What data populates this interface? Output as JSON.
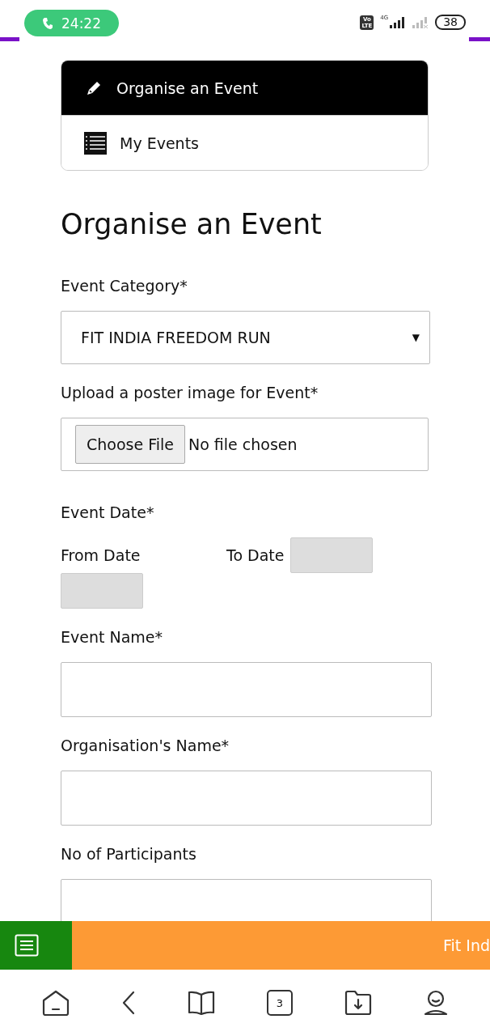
{
  "status_bar": {
    "call_time": "24:22",
    "volte_top": "Vo",
    "volte_bottom": "LTE",
    "network": "4G",
    "battery": "38"
  },
  "menu": [
    {
      "label": "Organise an Event",
      "kind": "pencil",
      "selected": true
    },
    {
      "label": "My Events",
      "kind": "list",
      "selected": false
    }
  ],
  "form": {
    "title": "Organise an Event",
    "fields": [
      {
        "kind": "select",
        "label": "Event Category*",
        "value": "FIT INDIA FREEDOM RUN",
        "arrow": "▼"
      },
      {
        "kind": "file",
        "label": "Upload a poster image for Event*",
        "button": "Choose File",
        "status": "No file chosen"
      },
      {
        "kind": "dates",
        "label": "Event Date*",
        "from_label": "From Date",
        "to_label": "To Date"
      },
      {
        "kind": "text",
        "label": "Event Name*"
      },
      {
        "kind": "text",
        "label": "Organisation's Name*"
      },
      {
        "kind": "text",
        "label": "No of Participants"
      }
    ]
  },
  "banner": {
    "text": "Fit Ind"
  },
  "bottom_nav": [
    {
      "kind": "home"
    },
    {
      "kind": "back"
    },
    {
      "kind": "book"
    },
    {
      "kind": "tabs",
      "count": "3"
    },
    {
      "kind": "download"
    },
    {
      "kind": "profile"
    }
  ]
}
